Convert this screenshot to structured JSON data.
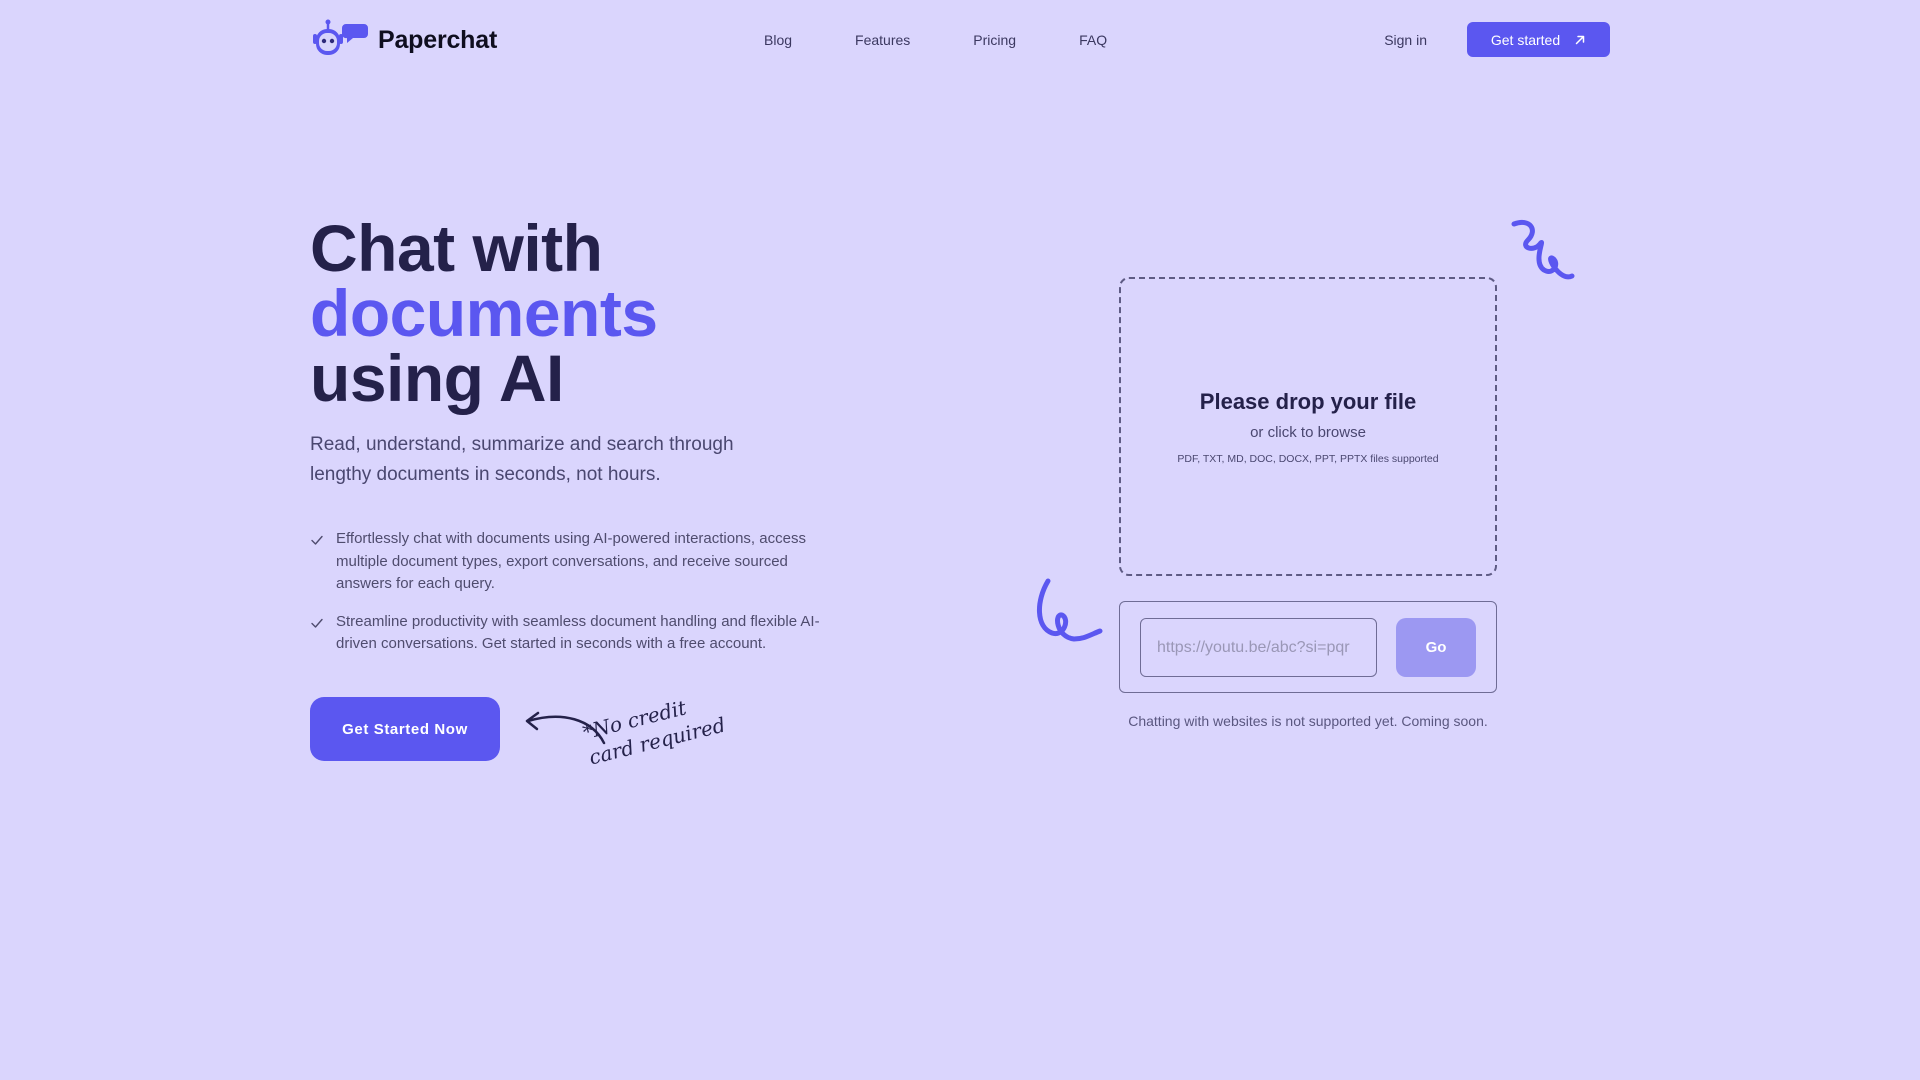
{
  "brand": {
    "name": "Paperchat",
    "logo_icon": "robot-chat-logo"
  },
  "nav": {
    "items": [
      {
        "label": "Blog"
      },
      {
        "label": "Features"
      },
      {
        "label": "Pricing"
      },
      {
        "label": "FAQ"
      }
    ],
    "sign_in": "Sign in",
    "cta_label": "Get started",
    "cta_icon": "arrow-up-right-icon"
  },
  "hero": {
    "title_line1": "Chat with",
    "title_accent": "documents",
    "title_line3": "using AI",
    "subtitle": "Read, understand, summarize and search through lengthy documents in seconds, not hours.",
    "features": [
      "Effortlessly chat with documents using AI-powered interactions, access multiple document types, export conversations, and receive sourced answers for each query.",
      "Streamline productivity with seamless document handling and flexible AI-driven conversations. Get started in seconds with a free account."
    ],
    "cta_label": "Get Started Now",
    "note": "*No credit card required"
  },
  "upload": {
    "title": "Please drop your file",
    "subtitle": "or click to browse",
    "types": "PDF, TXT, MD, DOC, DOCX, PPT, PPTX files supported"
  },
  "url_form": {
    "placeholder": "https://youtu.be/abc?si=pqr",
    "value": "",
    "go_label": "Go",
    "note": "Chatting with websites is not supported yet. Coming soon."
  },
  "colors": {
    "background": "#dad5fd",
    "accent": "#5b57f0",
    "accent_muted": "#9c98f2",
    "text_dark": "#24214a"
  }
}
